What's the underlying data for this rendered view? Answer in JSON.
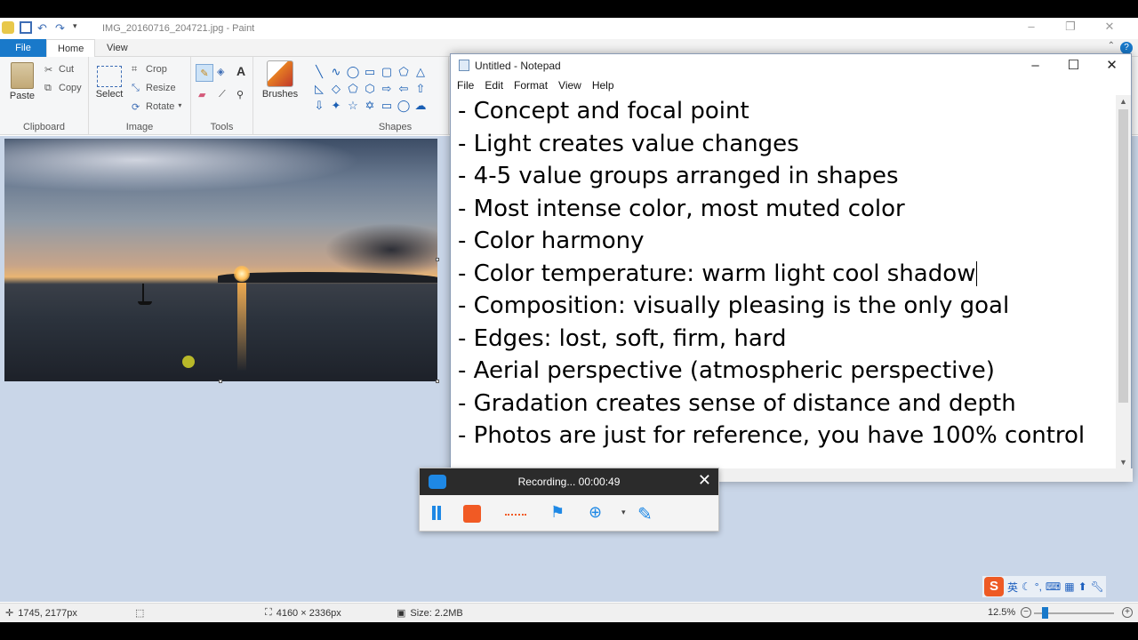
{
  "paint": {
    "title": "IMG_20160716_204721.jpg - Paint",
    "tabs": {
      "file": "File",
      "home": "Home",
      "view": "View"
    },
    "clipboard": {
      "paste": "Paste",
      "cut": "Cut",
      "copy": "Copy",
      "group": "Clipboard"
    },
    "image": {
      "select": "Select",
      "crop": "Crop",
      "resize": "Resize",
      "rotate": "Rotate",
      "group": "Image"
    },
    "tools": {
      "group": "Tools"
    },
    "brushes": {
      "label": "Brushes"
    },
    "shapes": {
      "group": "Shapes"
    },
    "status": {
      "cursor_pos": "1745, 2177px",
      "dimensions": "4160 × 2336px",
      "size": "Size: 2.2MB",
      "zoom": "12.5%"
    },
    "help_glyph": "?"
  },
  "ime": {
    "logo": "S",
    "lang": "英"
  },
  "notepad": {
    "title": "Untitled - Notepad",
    "menu": [
      "File",
      "Edit",
      "Format",
      "View",
      "Help"
    ],
    "lines": [
      "- Concept and focal point",
      "- Light creates value changes",
      "- 4-5 value groups arranged in shapes",
      "- Most intense color, most muted color",
      "- Color harmony",
      "- Color temperature: warm light cool shadow",
      "- Composition: visually pleasing is the only goal",
      "- Edges: lost, soft, firm, hard",
      "- Aerial perspective (atmospheric perspective)",
      "- Gradation creates sense of distance and depth",
      "- Photos are just for reference, you have 100% control"
    ]
  },
  "recorder": {
    "status": "Recording... 00:00:49"
  }
}
